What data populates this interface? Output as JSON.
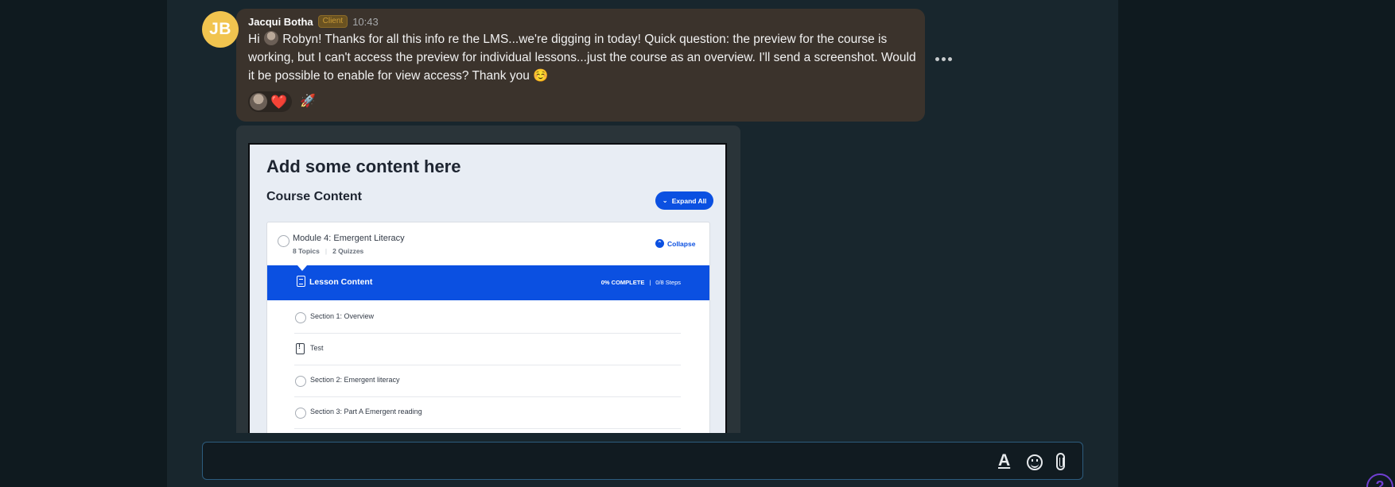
{
  "message": {
    "avatar_initials": "JB",
    "author": "Jacqui Botha",
    "role_badge": "Client",
    "time": "10:43",
    "text_greeting": "Hi",
    "text_body": "Robyn! Thanks for all this info re the LMS...we're digging in today! Quick question: the preview for the course is working, but I can't access the preview for individual lessons...just the course as an overview. I'll send a screenshot. Would it be possible to enable for view access? Thank you ☺️",
    "reactions": [
      {
        "emoji": "❤️",
        "icon": "heart-icon"
      },
      {
        "emoji": "🚀",
        "icon": "rocket-icon"
      }
    ]
  },
  "attachment": {
    "heading": "Add some content here",
    "section_title": "Course Content",
    "expand_button": "Expand All",
    "module": {
      "title": "Module 4: Emergent Literacy",
      "topics": "8 Topics",
      "quizzes": "2 Quizzes",
      "collapse_label": "Collapse"
    },
    "lesson": {
      "title": "Lesson Content",
      "progress": "0% COMPLETE",
      "steps": "0/8 Steps"
    },
    "items": [
      {
        "label": "Section 1: Overview",
        "icon": "circle-icon"
      },
      {
        "label": "Test",
        "icon": "quiz-icon"
      },
      {
        "label": "Section 2: Emergent literacy",
        "icon": "circle-icon"
      },
      {
        "label": "Section 3: Part A Emergent reading",
        "icon": "circle-icon"
      }
    ]
  },
  "composer": {
    "placeholder": "",
    "format_icon": "text-format-icon",
    "emoji_icon": "emoji-icon",
    "attach_icon": "paperclip-icon"
  },
  "help": {
    "label": "?"
  },
  "colors": {
    "avatar": "#f1c44f",
    "bubble": "#3b332c",
    "brand_blue": "#0b50e1",
    "help": "#6f3fd0"
  }
}
